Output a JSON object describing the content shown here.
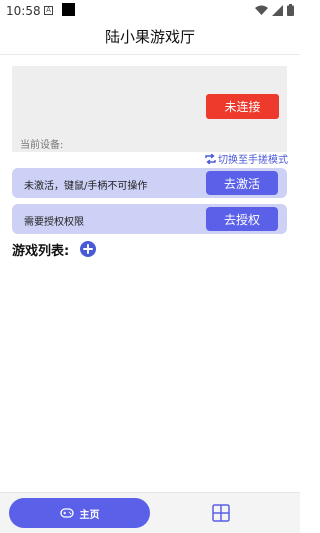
{
  "status_bar": {
    "time": "10:58",
    "a_indicator": "A",
    "icons": [
      "wifi-icon",
      "signal-icon",
      "battery-icon"
    ]
  },
  "app": {
    "title": "陆小果游戏厅"
  },
  "device": {
    "connect_status_label": "未连接",
    "current_device_label": "当前设备:"
  },
  "switch_mode_label": "切换至手搓模式",
  "activation": {
    "message": "未激活，键鼠/手柄不可操作",
    "button_label": "去激活"
  },
  "authorization": {
    "message": "需要授权权限",
    "button_label": "去授权"
  },
  "games": {
    "label": "游戏列表:"
  },
  "bottom_nav": {
    "home_label": "主页"
  },
  "colors": {
    "accent": "#5b60e8",
    "banner_bg": "#ccd1f5",
    "disconnected": "#ee3a2c",
    "link": "#4a5ad6"
  }
}
